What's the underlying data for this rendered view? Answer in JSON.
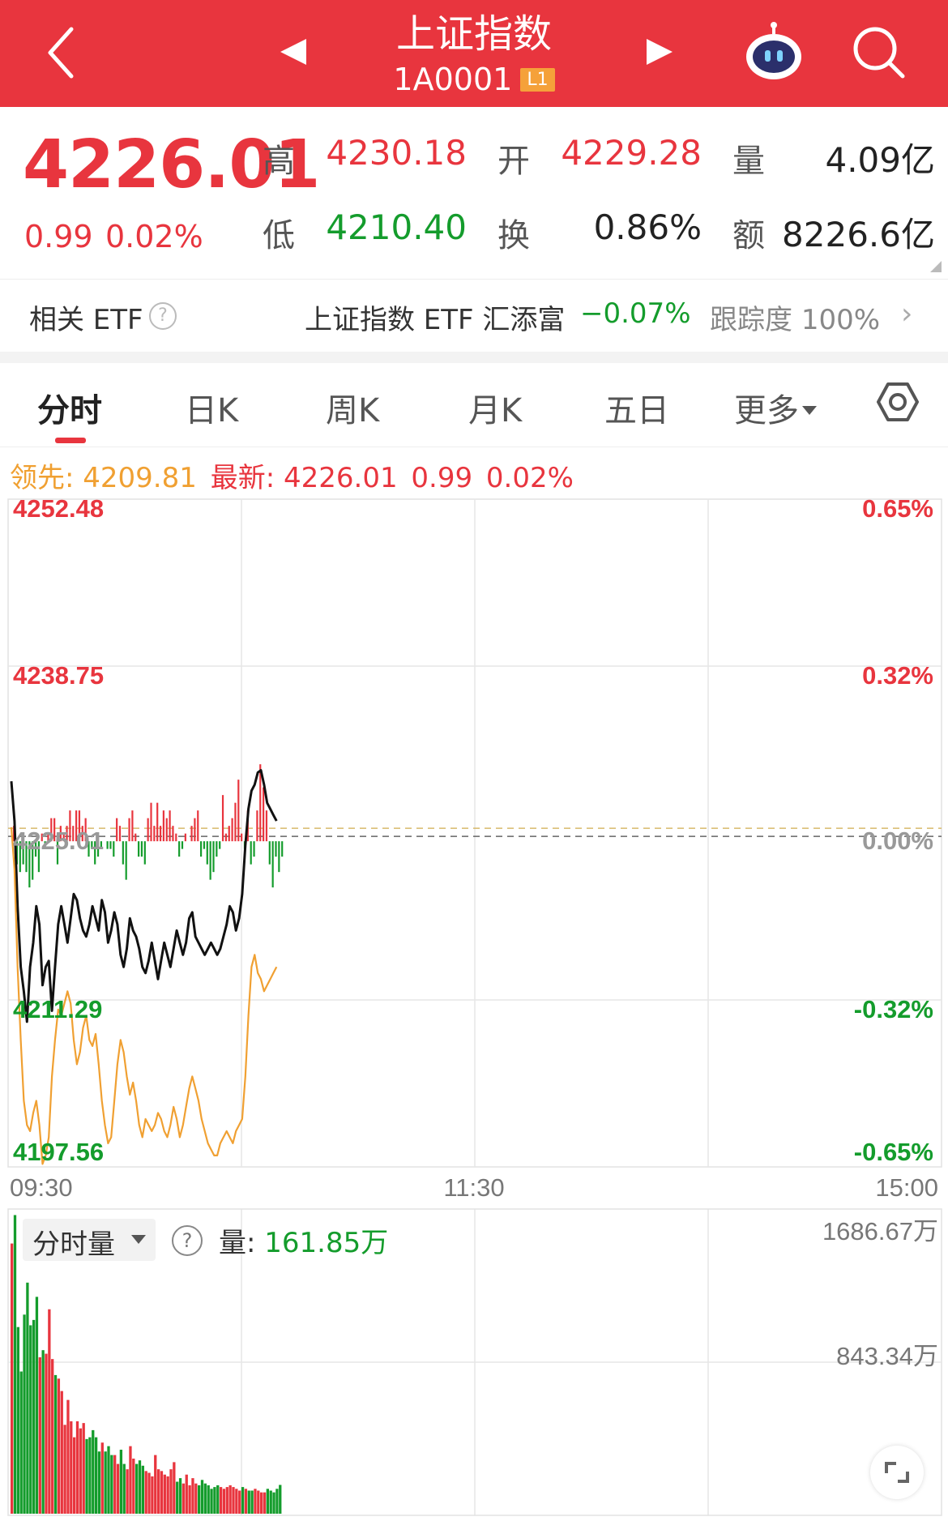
{
  "header": {
    "title": "上证指数",
    "code": "1A0001",
    "level_badge": "L1",
    "bg_color": "#e8353e"
  },
  "quote": {
    "price": "4226.01",
    "change": "0.99",
    "change_pct": "0.02%",
    "high_label": "高",
    "high": "4230.18",
    "open_label": "开",
    "open": "4229.28",
    "volume_label": "量",
    "volume": "4.09亿",
    "low_label": "低",
    "low": "4210.40",
    "turnover_label": "换",
    "turnover": "0.86%",
    "amount_label": "额",
    "amount": "8226.6亿"
  },
  "etf": {
    "label": "相关 ETF",
    "help_icon": "?",
    "name": "上证指数 ETF 汇添富",
    "change_pct": "−0.07%",
    "tracking_label": "跟踪度",
    "tracking": "100%",
    "arrow": "›"
  },
  "tabs": [
    {
      "label": "分时",
      "active": true
    },
    {
      "label": "日K",
      "active": false
    },
    {
      "label": "周K",
      "active": false
    },
    {
      "label": "月K",
      "active": false
    },
    {
      "label": "五日",
      "active": false
    },
    {
      "label": "更多",
      "active": false
    }
  ],
  "legend": {
    "lead_label": "领先:",
    "lead_value": "4209.81",
    "latest_label": "最新:",
    "latest_value": "4226.01",
    "latest_change": "0.99",
    "latest_pct": "0.02%"
  },
  "chart_data": {
    "type": "line",
    "y_left_labels": [
      "4252.48",
      "4238.75",
      "4225.01",
      "4211.29",
      "4197.56"
    ],
    "y_right_labels": [
      "0.65%",
      "0.32%",
      "0.00%",
      "-0.32%",
      "-0.65%"
    ],
    "ylim": [
      4197.56,
      4252.48
    ],
    "prev_close": 4225.01,
    "x_labels": [
      "09:30",
      "11:30",
      "15:00"
    ],
    "colors": {
      "up": "#e8353e",
      "down": "#149c2c",
      "price": "#111111",
      "lead": "#f0a032"
    },
    "series": [
      {
        "name": "最新",
        "values": [
          4229.28,
          4226,
          4219,
          4214,
          4212,
          4209.5,
          4214,
          4216,
          4219,
          4217.5,
          4212.5,
          4214,
          4214.5,
          4210.4,
          4214,
          4217.5,
          4219,
          4217.5,
          4216,
          4218,
          4220,
          4219.5,
          4218,
          4217,
          4216.5,
          4217.5,
          4219,
          4218,
          4217,
          4219.5,
          4218.5,
          4216,
          4217,
          4218.5,
          4217.5,
          4215,
          4214,
          4215.5,
          4218,
          4217,
          4216.5,
          4215.5,
          4214,
          4213.5,
          4214.5,
          4216,
          4214.5,
          4213,
          4214.5,
          4216,
          4215,
          4214,
          4215.5,
          4217,
          4216,
          4215,
          4216,
          4218,
          4218.5,
          4216.5,
          4216,
          4215.5,
          4215,
          4215.5,
          4216,
          4215.5,
          4215,
          4215.5,
          4216.5,
          4217.5,
          4219,
          4218.5,
          4217,
          4218,
          4220,
          4224,
          4227,
          4228.5,
          4229,
          4230,
          4230.18,
          4229,
          4227.5,
          4227,
          4226.5,
          4226.01
        ]
      },
      {
        "name": "领先",
        "values": [
          4225.5,
          4222,
          4214,
          4208,
          4203,
          4201,
          4200.5,
          4202,
          4203,
          4201,
          4197.8,
          4198.5,
          4200,
          4205,
          4208,
          4210.5,
          4210,
          4211,
          4212,
          4211,
          4208,
          4206,
          4207,
          4209,
          4210,
          4208,
          4207.5,
          4208.5,
          4206,
          4203,
          4201,
          4199.5,
          4200,
          4203,
          4206,
          4208,
          4207,
          4205,
          4203.5,
          4204.5,
          4203,
          4201,
          4200,
          4201.5,
          4201,
          4200.5,
          4201,
          4202,
          4201.5,
          4200.5,
          4200,
          4201,
          4202.5,
          4201.5,
          4200,
          4201,
          4202.5,
          4204,
          4205,
          4204,
          4203,
          4201.5,
          4200.5,
          4199.5,
          4199,
          4198.5,
          4198.5,
          4199.5,
          4200,
          4200.5,
          4200,
          4199.5,
          4200.5,
          4201,
          4201.5,
          4205,
          4210,
          4214,
          4215,
          4213.5,
          4213,
          4212,
          4212.5,
          4213,
          4213.5,
          4214
        ]
      }
    ],
    "change_bars": [
      2,
      -3,
      -4,
      -3,
      -4,
      -6,
      -5,
      -2,
      -4,
      1,
      -1,
      1,
      3,
      3,
      -3,
      2,
      1,
      2,
      4,
      2,
      4,
      4,
      2,
      3,
      -2,
      -1,
      -3,
      -2,
      -1,
      0,
      -1,
      -1,
      -2,
      3,
      2,
      -3,
      -5,
      3,
      4,
      1,
      -2,
      -2,
      -3,
      3,
      5,
      2,
      5,
      2,
      4,
      3,
      4,
      2,
      1,
      -2,
      -1,
      1,
      0,
      2,
      3,
      4,
      -2,
      -1,
      -3,
      -5,
      -4,
      -2,
      -1,
      6,
      1,
      2,
      3,
      5,
      8,
      1,
      -1,
      4,
      -3,
      -2,
      4,
      10,
      7,
      4,
      -3,
      -6,
      -2,
      -4,
      -2
    ],
    "volume": {
      "label": "分时量",
      "current_label": "量:",
      "current": "161.85万",
      "y_labels": [
        "1686.67万",
        "843.34万"
      ],
      "ymax": 1686.67,
      "bars": [
        1520,
        1680,
        1050,
        800,
        1120,
        1300,
        1060,
        1090,
        1220,
        880,
        920,
        900,
        1150,
        870,
        780,
        760,
        690,
        500,
        640,
        520,
        430,
        520,
        480,
        510,
        420,
        430,
        470,
        430,
        350,
        400,
        350,
        380,
        330,
        330,
        280,
        360,
        280,
        250,
        380,
        310,
        280,
        300,
        270,
        240,
        230,
        210,
        330,
        250,
        240,
        220,
        210,
        250,
        290,
        180,
        200,
        170,
        220,
        160,
        200,
        170,
        160,
        190,
        170,
        160,
        140,
        150,
        160,
        150,
        140,
        150,
        160,
        150,
        140,
        130,
        150,
        140,
        130,
        130,
        140,
        130,
        120,
        120,
        140,
        130,
        120,
        140,
        162
      ]
    }
  }
}
